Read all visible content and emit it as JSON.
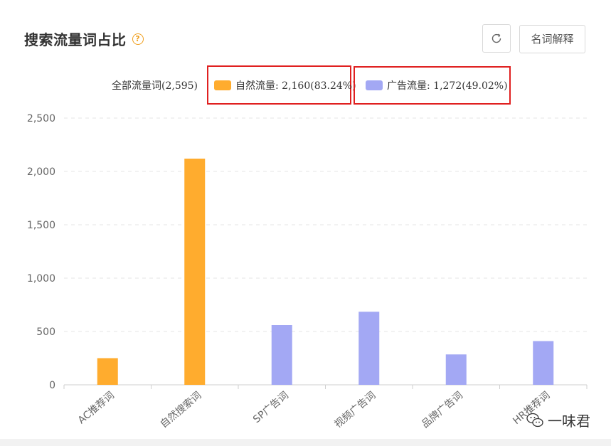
{
  "header": {
    "title": "搜索流量词占比",
    "help_icon": "question-circle-icon"
  },
  "toolbar": {
    "refresh_icon": "refresh-icon",
    "explain_label": "名词解释"
  },
  "legend": {
    "all_label": "全部流量词(2,595)",
    "organic_label": "自然流量: 2,160(83.24%)",
    "ads_label": "广告流量: 1,272(49.02%)"
  },
  "colors": {
    "organic": "#ffac2e",
    "ads": "#a3a8f4",
    "highlight": "#e02020"
  },
  "chart_data": {
    "type": "bar",
    "categories": [
      "AC推荐词",
      "自然搜索词",
      "SP广告词",
      "视频广告词",
      "品牌广告词",
      "HR推荐词"
    ],
    "values": [
      250,
      2120,
      560,
      685,
      285,
      410
    ],
    "groups": [
      "organic",
      "organic",
      "ads",
      "ads",
      "ads",
      "ads"
    ],
    "ylim": [
      0,
      2500
    ],
    "yticks": [
      0,
      500,
      1000,
      1500,
      2000,
      2500
    ],
    "ytick_labels": [
      "0",
      "500",
      "1,000",
      "1,500",
      "2,000",
      "2,500"
    ],
    "grid": true,
    "legend_position": "top"
  },
  "watermark": {
    "text": "一味君",
    "icon": "wechat-icon"
  }
}
